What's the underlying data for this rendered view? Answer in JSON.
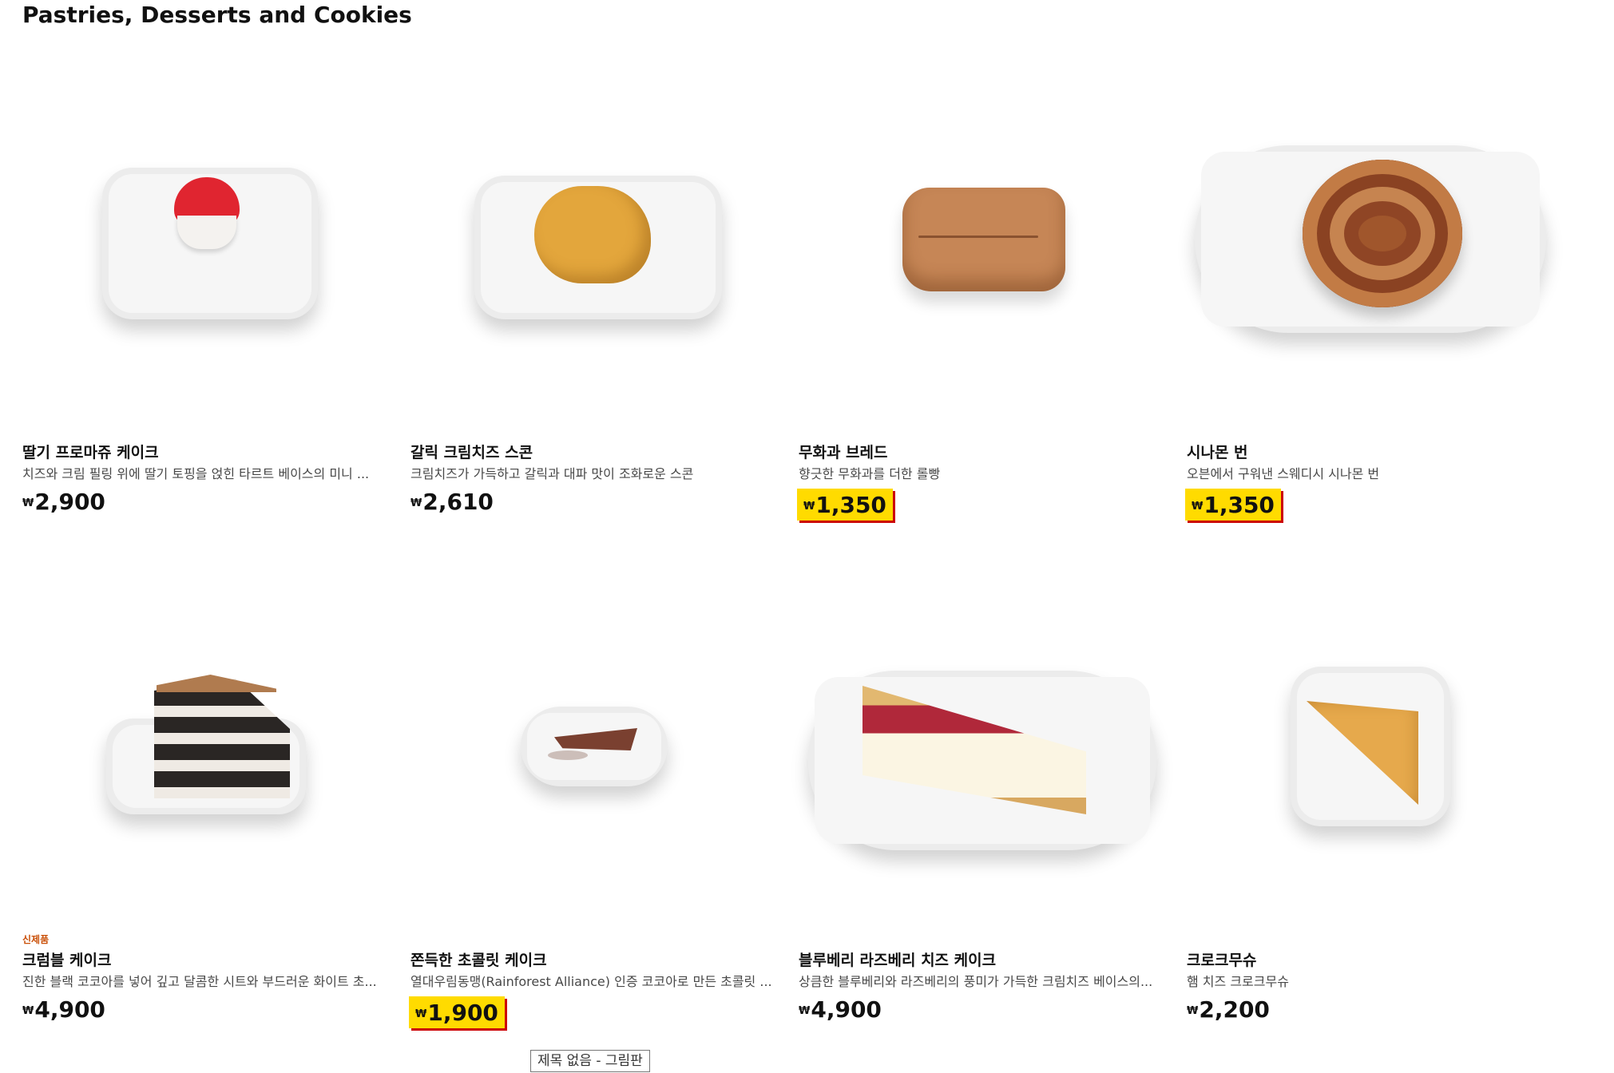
{
  "page": {
    "title": "Pastries, Desserts and Cookies"
  },
  "products": [
    {
      "name": "딸기 프로마쥬 케이크",
      "description": "치즈와 크림 필링 위에 딸기 토핑을 얹힌 타르트 베이스의 미니 ...",
      "currency": "₩",
      "price": "2,900",
      "highlight": false,
      "badge": ""
    },
    {
      "name": "갈릭 크림치즈 스콘",
      "description": "크림치즈가 가득하고 갈릭과 대파 맛이 조화로운 스콘",
      "currency": "₩",
      "price": "2,610",
      "highlight": false,
      "badge": ""
    },
    {
      "name": "무화과 브레드",
      "description": "향긋한 무화과를 더한 롤빵",
      "currency": "₩",
      "price": "1,350",
      "highlight": true,
      "badge": ""
    },
    {
      "name": "시나몬 번",
      "description": "오븐에서 구워낸 스웨디시 시나몬 번",
      "currency": "₩",
      "price": "1,350",
      "highlight": true,
      "badge": ""
    },
    {
      "name": "크럼블 케이크",
      "description": "진한 블랙 코코아를 넣어 깊고 달콤한 시트와 부드러운 화이트 초...",
      "currency": "₩",
      "price": "4,900",
      "highlight": false,
      "badge": "신제품"
    },
    {
      "name": "쫀득한 초콜릿 케이크",
      "description": "열대우림동맹(Rainforest Alliance) 인증 코코아로 만든 초콜릿 ...",
      "currency": "₩",
      "price": "1,900",
      "highlight": true,
      "badge": ""
    },
    {
      "name": "블루베리 라즈베리 치즈 케이크",
      "description": "상큼한 블루베리와 라즈베리의 풍미가 가득한 크림치즈 베이스의...",
      "currency": "₩",
      "price": "4,900",
      "highlight": false,
      "badge": ""
    },
    {
      "name": "크로크무슈",
      "description": "햄 치즈 크로크무슈",
      "currency": "₩",
      "price": "2,200",
      "highlight": false,
      "badge": ""
    }
  ],
  "tooltip": {
    "text": "제목 없음 - 그림판"
  }
}
